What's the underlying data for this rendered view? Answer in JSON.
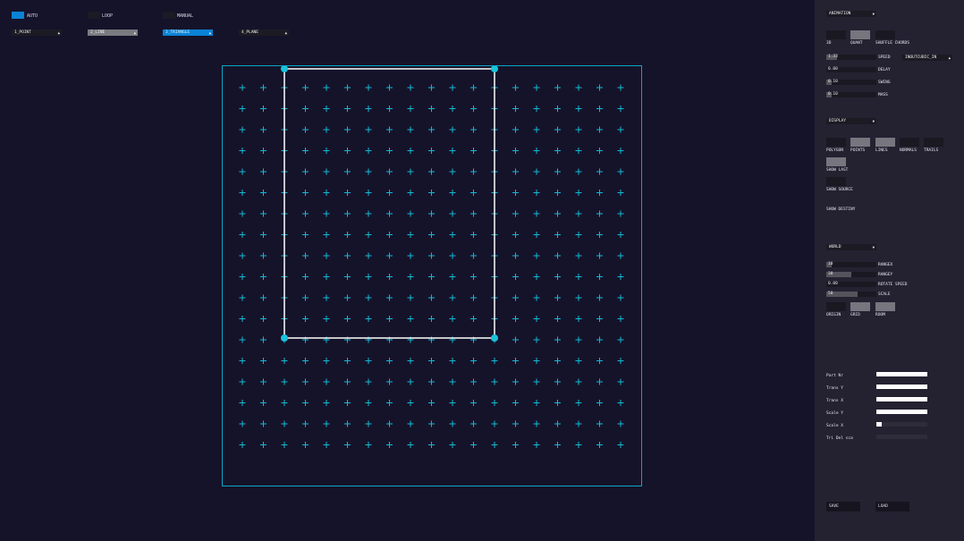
{
  "top": {
    "modes": [
      {
        "label": "AUTO",
        "on": true
      },
      {
        "label": "LOOP",
        "on": false
      },
      {
        "label": "MANUAL",
        "on": false
      }
    ],
    "shapes": [
      {
        "label": "1_POINT",
        "state": "normal"
      },
      {
        "label": "2_LINE",
        "state": "gray"
      },
      {
        "label": "3_TRIANGLE",
        "state": "active"
      },
      {
        "label": "4_PLANE",
        "state": "normal"
      }
    ]
  },
  "panel": {
    "animation_dd": "ANIMATION",
    "anim_toggles": [
      {
        "label": "3D",
        "on": false
      },
      {
        "label": "QUANT",
        "on": true
      },
      {
        "label": "SHUFFLE CHORDS",
        "on": false
      }
    ],
    "anim_sliders": [
      {
        "value": "1.33",
        "label": "SPEED",
        "fill": 0.22
      },
      {
        "value": "0.00",
        "label": "DELAY",
        "fill": 0
      },
      {
        "value": "0.10",
        "label": "SWING",
        "fill": 0.1
      },
      {
        "value": "0.10",
        "label": "MASS",
        "fill": 0.1
      }
    ],
    "easing_dd": "INOUTCUBIC_IN",
    "display_dd": "DISPLAY",
    "display_toggles": [
      {
        "label": "POLYGON",
        "on": false
      },
      {
        "label": "POINTS",
        "on": true
      },
      {
        "label": "LINES",
        "on": true
      },
      {
        "label": "NORMALS",
        "on": false
      },
      {
        "label": "TRAILS",
        "on": false
      }
    ],
    "show_last": {
      "label": "SHOW LAST",
      "on": true
    },
    "show_source": {
      "label": "SHOW SOURCE",
      "on": false
    },
    "show_destiny": {
      "label": "SHOW DESTINY"
    },
    "world_dd": "WORLD",
    "world_sliders": [
      {
        "value": "10",
        "label": "RANGEX",
        "fill": 0.1
      },
      {
        "value": "30",
        "label": "RANGEY",
        "fill": 0.5
      },
      {
        "value": "0.00",
        "label": "ROTATE SPEED",
        "fill": 0
      },
      {
        "value": "50",
        "label": "SCALE",
        "fill": 0.62
      }
    ],
    "world_toggles": [
      {
        "label": "ORIGIN",
        "on": false
      },
      {
        "label": "GRID",
        "on": true
      },
      {
        "label": "ROOM",
        "on": true
      }
    ],
    "params": [
      {
        "label": "Part Nr",
        "level": 1.0
      },
      {
        "label": "Trans Y",
        "level": 1.0
      },
      {
        "label": "Trans X",
        "level": 1.0
      },
      {
        "label": "Scale Y",
        "level": 1.0
      },
      {
        "label": "Scale X",
        "level": 0.1
      },
      {
        "label": "Tri Del sca",
        "level": 0.0
      }
    ],
    "save_label": "SAVE",
    "load_label": "LOAD"
  },
  "colors": {
    "accent": "#0a83d6",
    "grid_cross": "#12b8d6",
    "frame": "#0aa7c6",
    "rect": "#ffffff",
    "vertex": "#1ac3da"
  },
  "canvas": {
    "grid_cols": 19,
    "grid_rows": 18,
    "rect_cols": [
      2,
      12
    ],
    "rect_rows": [
      0,
      12
    ]
  }
}
